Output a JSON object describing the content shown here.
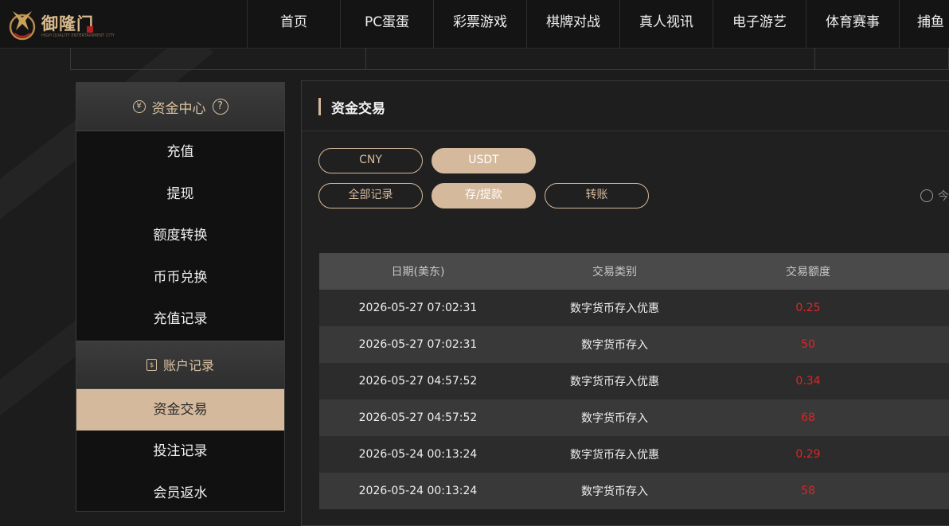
{
  "brand": {
    "name": "御隆门",
    "tagline": "HIGH QUALITY ENTERTAINMENT CITY"
  },
  "nav": [
    "首页",
    "PC蛋蛋",
    "彩票游戏",
    "棋牌对战",
    "真人视讯",
    "电子游艺",
    "体育赛事",
    "捕鱼"
  ],
  "sidebar": {
    "fund_center": "资金中心",
    "fund_items": [
      "充值",
      "提现",
      "额度转换",
      "币币兑换",
      "充值记录"
    ],
    "account_records": "账户记录",
    "record_items": [
      "资金交易",
      "投注记录",
      "会员返水"
    ],
    "active_item": "资金交易"
  },
  "main": {
    "title": "资金交易",
    "currency_tabs": [
      "CNY",
      "USDT"
    ],
    "selected_currency": "USDT",
    "record_tabs": [
      "全部记录",
      "存/提款",
      "转账"
    ],
    "selected_record": "存/提款",
    "radio_label": "今"
  },
  "table": {
    "headers": [
      "日期(美东)",
      "交易类别",
      "交易额度"
    ],
    "rows": [
      {
        "date": "2026-05-27 07:02:31",
        "type": "数字货币存入优惠",
        "amount": "0.25"
      },
      {
        "date": "2026-05-27 07:02:31",
        "type": "数字货币存入",
        "amount": "50"
      },
      {
        "date": "2026-05-27 04:57:52",
        "type": "数字货币存入优惠",
        "amount": "0.34"
      },
      {
        "date": "2026-05-27 04:57:52",
        "type": "数字货币存入",
        "amount": "68"
      },
      {
        "date": "2026-05-24 00:13:24",
        "type": "数字货币存入优惠",
        "amount": "0.29"
      },
      {
        "date": "2026-05-24 00:13:24",
        "type": "数字货币存入",
        "amount": "58"
      }
    ]
  },
  "icons": {
    "fund_center": "yen-coin-icon",
    "help": "question-circle-icon",
    "account_records": "document-icon",
    "logo": "dragon-logo-icon"
  },
  "colors": {
    "accent": "#d5b99c",
    "amount": "#e02424",
    "background": "#1c1c1c"
  }
}
